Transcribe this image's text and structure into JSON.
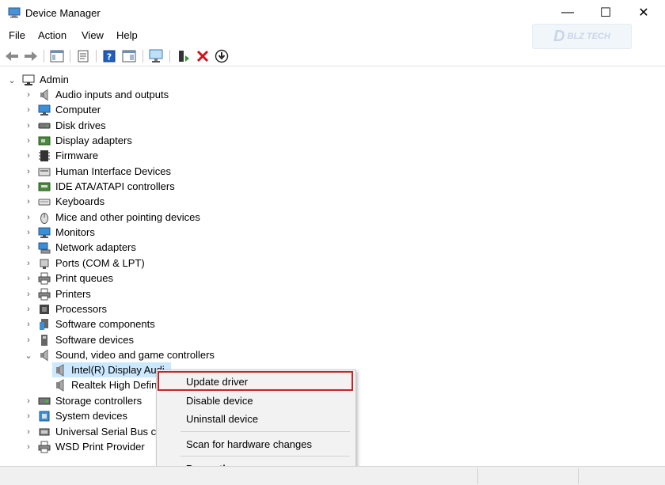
{
  "window": {
    "title": "Device Manager",
    "minimize_glyph": "—",
    "maximize_glyph": "☐",
    "close_glyph": "✕"
  },
  "menu": [
    "File",
    "Action",
    "View",
    "Help"
  ],
  "watermark": {
    "letter": "D",
    "text": "BLZ TECH"
  },
  "toolbar": [
    "back-icon",
    "forward-icon",
    "show-hide-tree-icon",
    "properties-icon",
    "help-icon",
    "view-icon",
    "scan-monitor-icon",
    "add-driver-icon",
    "uninstall-x-icon",
    "update-down-icon"
  ],
  "tree": {
    "root": "Admin",
    "categories": [
      {
        "label": "Audio inputs and outputs",
        "icon": "speaker-icon"
      },
      {
        "label": "Computer",
        "icon": "computer-icon"
      },
      {
        "label": "Disk drives",
        "icon": "disk-icon"
      },
      {
        "label": "Display adapters",
        "icon": "display-adapter-icon"
      },
      {
        "label": "Firmware",
        "icon": "chip-icon"
      },
      {
        "label": "Human Interface Devices",
        "icon": "hid-icon"
      },
      {
        "label": "IDE ATA/ATAPI controllers",
        "icon": "ide-icon"
      },
      {
        "label": "Keyboards",
        "icon": "keyboard-icon"
      },
      {
        "label": "Mice and other pointing devices",
        "icon": "mouse-icon"
      },
      {
        "label": "Monitors",
        "icon": "monitor-icon"
      },
      {
        "label": "Network adapters",
        "icon": "network-icon"
      },
      {
        "label": "Ports (COM & LPT)",
        "icon": "port-icon"
      },
      {
        "label": "Print queues",
        "icon": "printer-icon"
      },
      {
        "label": "Printers",
        "icon": "printer-icon"
      },
      {
        "label": "Processors",
        "icon": "processor-icon"
      },
      {
        "label": "Software components",
        "icon": "software-component-icon"
      },
      {
        "label": "Software devices",
        "icon": "software-device-icon"
      },
      {
        "label": "Sound, video and game controllers",
        "icon": "speaker-icon"
      },
      {
        "label": "Storage controllers",
        "icon": "storage-icon"
      },
      {
        "label": "System devices",
        "icon": "system-icon"
      },
      {
        "label": "Universal Serial Bus co",
        "icon": "usb-icon"
      },
      {
        "label": "WSD Print Provider",
        "icon": "printer-icon"
      }
    ],
    "sound_children": [
      "Intel(R) Display Audi",
      "Realtek High Defin"
    ]
  },
  "context_menu": {
    "update": "Update driver",
    "disable": "Disable device",
    "uninstall": "Uninstall device",
    "scan": "Scan for hardware changes",
    "properties": "Properties"
  },
  "colors": {
    "selection": "#cce8ff",
    "highlight_border": "#c8232c",
    "accent_blue": "#2b7bd6"
  }
}
